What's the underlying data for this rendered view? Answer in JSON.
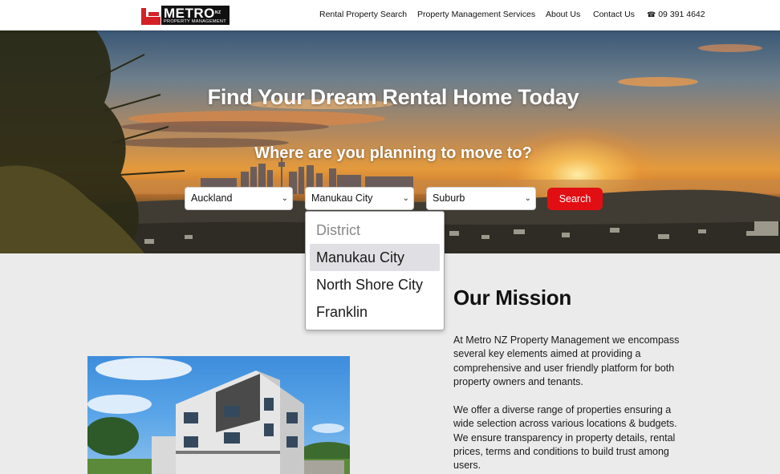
{
  "header": {
    "logo": {
      "word": "METRO",
      "nz": "NZ",
      "subtitle": "PROPERTY MANAGEMENT"
    },
    "nav": [
      {
        "label": "Rental Property Search"
      },
      {
        "label": "Property Management Services"
      },
      {
        "label": "About Us"
      },
      {
        "label": "Contact Us"
      }
    ],
    "phone": {
      "icon": "phone-icon",
      "label": "09 391 4642"
    }
  },
  "hero": {
    "title": "Find Your Dream Rental Home Today",
    "subtitle": "Where are you planning to move to?",
    "region_select": {
      "value": "Auckland"
    },
    "district_select": {
      "value": "Manukau City"
    },
    "suburb_select": {
      "value": "Suburb"
    },
    "search_label": "Search"
  },
  "district_dropdown": {
    "options": [
      {
        "label": "District",
        "state": "disabled"
      },
      {
        "label": "Manukau City",
        "state": "selected"
      },
      {
        "label": "North Shore City",
        "state": "normal"
      },
      {
        "label": "Franklin",
        "state": "normal"
      }
    ]
  },
  "mission": {
    "title": "Our Mission",
    "paragraph1": "At Metro NZ Property Management we encompass several key elements aimed at providing a comprehensive and user friendly platform for both property owners and tenants.",
    "paragraph2": "We offer a diverse range of properties ensuring a wide selection across various locations & budgets. We ensure transparency in property details, rental prices, terms and conditions to build trust among users."
  },
  "colors": {
    "accent": "#e10f14",
    "brand_red": "#d42027",
    "page_bg": "#ebebeb"
  }
}
